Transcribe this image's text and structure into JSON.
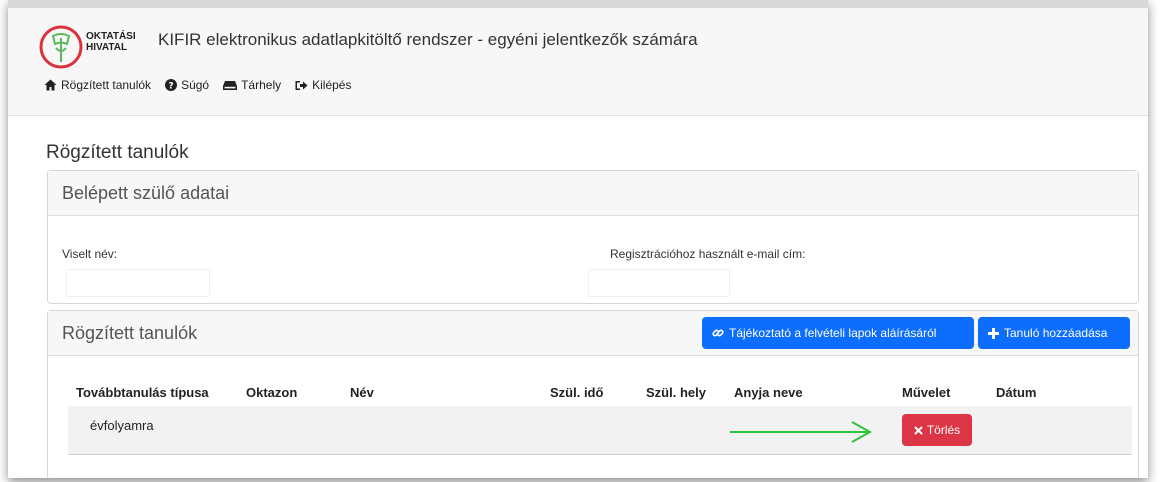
{
  "header": {
    "logo_line1": "OKTATÁSI",
    "logo_line2": "HIVATAL",
    "app_title": "KIFIR elektronikus adatlapkitöltő rendszer - egyéni jelentkezők számára"
  },
  "nav": [
    {
      "label": "Rögzített tanulók",
      "icon": "home-icon"
    },
    {
      "label": "Súgó",
      "icon": "question-circle-icon"
    },
    {
      "label": "Tárhely",
      "icon": "drive-icon"
    },
    {
      "label": "Kilépés",
      "icon": "sign-out-icon"
    }
  ],
  "page_title": "Rögzített tanulók",
  "parent_card": {
    "title": "Belépett szülő adatai",
    "name_label": "Viselt név:",
    "name_value": "",
    "email_label": "Regisztrációhoz használt e-mail cím:",
    "email_value": ""
  },
  "students_card": {
    "title": "Rögzített tanulók",
    "info_button": "Tájékoztató a felvételi lapok aláírásáról",
    "add_button": "Tanuló hozzáadása",
    "columns": [
      "Továbbtanulás típusa",
      "Oktazon",
      "Név",
      "Szül. idő",
      "Szül. hely",
      "Anyja neve",
      "Művelet",
      "Dátum"
    ],
    "rows": [
      {
        "type": "évfolyamra",
        "oktazon": "",
        "name": "",
        "birth_date": "",
        "birth_place": "",
        "mother": "",
        "action": "Törlés",
        "date": ""
      }
    ]
  },
  "colors": {
    "primary": "#0d6efd",
    "danger": "#dc3545",
    "arrow": "#2ec33a",
    "logo_green": "#5cb85c",
    "logo_red": "#d9343c"
  }
}
